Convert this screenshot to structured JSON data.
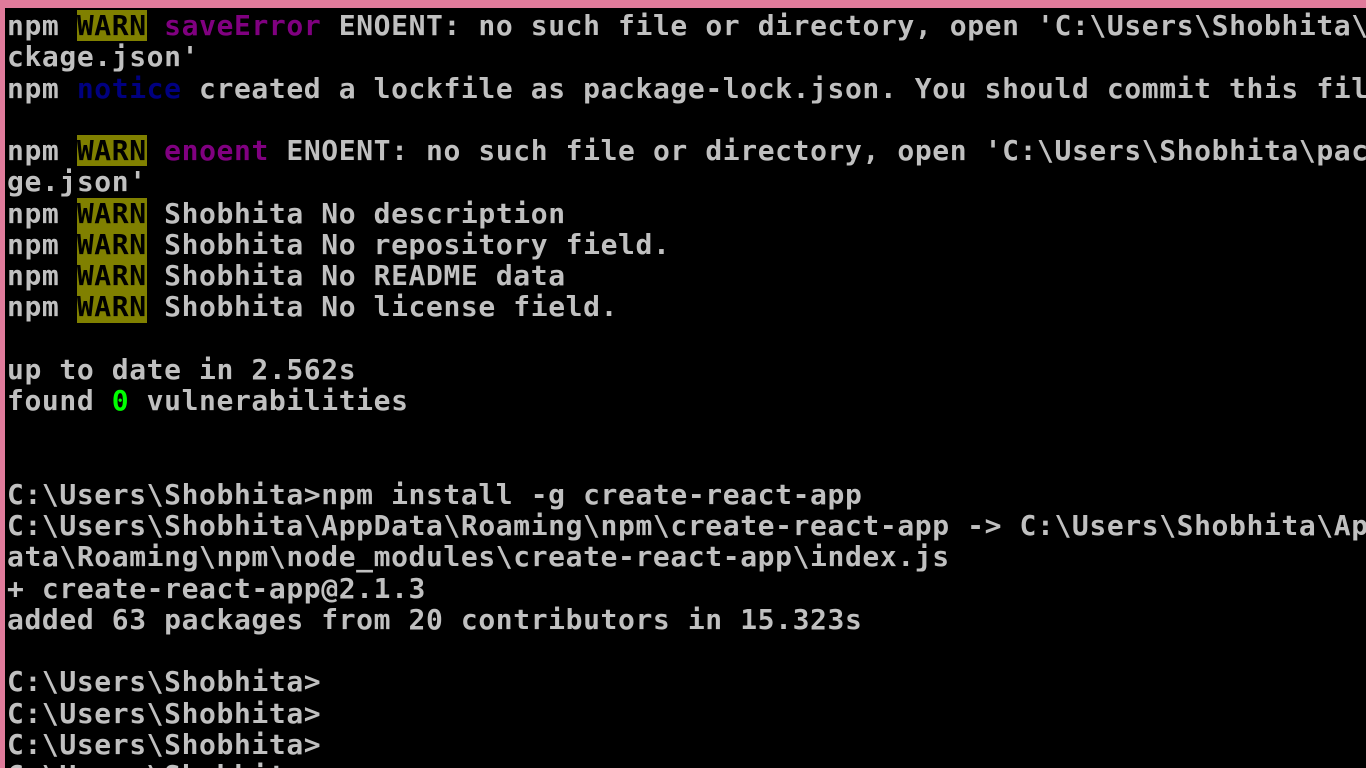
{
  "terminal": {
    "lines": [
      {
        "segments": [
          {
            "text": "npm ",
            "style": "normal"
          },
          {
            "text": "WARN",
            "style": "warn"
          },
          {
            "text": " ",
            "style": "normal"
          },
          {
            "text": "saveError",
            "style": "magenta"
          },
          {
            "text": " ENOENT: no such file or directory, open 'C:\\Users\\Shobhita\\pa",
            "style": "normal"
          }
        ]
      },
      {
        "segments": [
          {
            "text": "ckage.json'",
            "style": "normal"
          }
        ]
      },
      {
        "segments": [
          {
            "text": "npm ",
            "style": "normal"
          },
          {
            "text": "notice",
            "style": "blue"
          },
          {
            "text": " created a lockfile as package-lock.json. You should commit this file.",
            "style": "normal"
          }
        ]
      },
      {
        "segments": [
          {
            "text": "",
            "style": "normal"
          }
        ]
      },
      {
        "segments": [
          {
            "text": "npm ",
            "style": "normal"
          },
          {
            "text": "WARN",
            "style": "warn"
          },
          {
            "text": " ",
            "style": "normal"
          },
          {
            "text": "enoent",
            "style": "magenta"
          },
          {
            "text": " ENOENT: no such file or directory, open 'C:\\Users\\Shobhita\\packa",
            "style": "normal"
          }
        ]
      },
      {
        "segments": [
          {
            "text": "ge.json'",
            "style": "normal"
          }
        ]
      },
      {
        "segments": [
          {
            "text": "npm ",
            "style": "normal"
          },
          {
            "text": "WARN",
            "style": "warn"
          },
          {
            "text": " Shobhita No description",
            "style": "normal"
          }
        ]
      },
      {
        "segments": [
          {
            "text": "npm ",
            "style": "normal"
          },
          {
            "text": "WARN",
            "style": "warn"
          },
          {
            "text": " Shobhita No repository field.",
            "style": "normal"
          }
        ]
      },
      {
        "segments": [
          {
            "text": "npm ",
            "style": "normal"
          },
          {
            "text": "WARN",
            "style": "warn"
          },
          {
            "text": " Shobhita No README data",
            "style": "normal"
          }
        ]
      },
      {
        "segments": [
          {
            "text": "npm ",
            "style": "normal"
          },
          {
            "text": "WARN",
            "style": "warn"
          },
          {
            "text": " Shobhita No license field.",
            "style": "normal"
          }
        ]
      },
      {
        "segments": [
          {
            "text": "",
            "style": "normal"
          }
        ]
      },
      {
        "segments": [
          {
            "text": "up to date in 2.562s",
            "style": "normal"
          }
        ]
      },
      {
        "segments": [
          {
            "text": "found ",
            "style": "normal"
          },
          {
            "text": "0",
            "style": "green"
          },
          {
            "text": " vulnerabilities",
            "style": "normal"
          }
        ]
      },
      {
        "segments": [
          {
            "text": "",
            "style": "normal"
          }
        ]
      },
      {
        "segments": [
          {
            "text": "",
            "style": "normal"
          }
        ]
      },
      {
        "segments": [
          {
            "text": "C:\\Users\\Shobhita>npm install -g create-react-app",
            "style": "normal"
          }
        ]
      },
      {
        "segments": [
          {
            "text": "C:\\Users\\Shobhita\\AppData\\Roaming\\npm\\create-react-app -> C:\\Users\\Shobhita\\AppD",
            "style": "normal"
          }
        ]
      },
      {
        "segments": [
          {
            "text": "ata\\Roaming\\npm\\node_modules\\create-react-app\\index.js",
            "style": "normal"
          }
        ]
      },
      {
        "segments": [
          {
            "text": "+ create-react-app@2.1.3",
            "style": "normal"
          }
        ]
      },
      {
        "segments": [
          {
            "text": "added 63 packages from 20 contributors in 15.323s",
            "style": "normal"
          }
        ]
      },
      {
        "segments": [
          {
            "text": "",
            "style": "normal"
          }
        ]
      },
      {
        "segments": [
          {
            "text": "C:\\Users\\Shobhita>",
            "style": "normal"
          }
        ]
      },
      {
        "segments": [
          {
            "text": "C:\\Users\\Shobhita>",
            "style": "normal"
          }
        ]
      },
      {
        "segments": [
          {
            "text": "C:\\Users\\Shobhita>",
            "style": "normal"
          }
        ]
      },
      {
        "segments": [
          {
            "text": "C:\\Users\\Shobhita>",
            "style": "normal"
          }
        ]
      }
    ]
  },
  "colors": {
    "background": "#000000",
    "text": "#c0c0c0",
    "warn_bg": "#808000",
    "magenta": "#800080",
    "blue": "#000080",
    "green": "#00ff00",
    "border": "#e07b9b"
  }
}
